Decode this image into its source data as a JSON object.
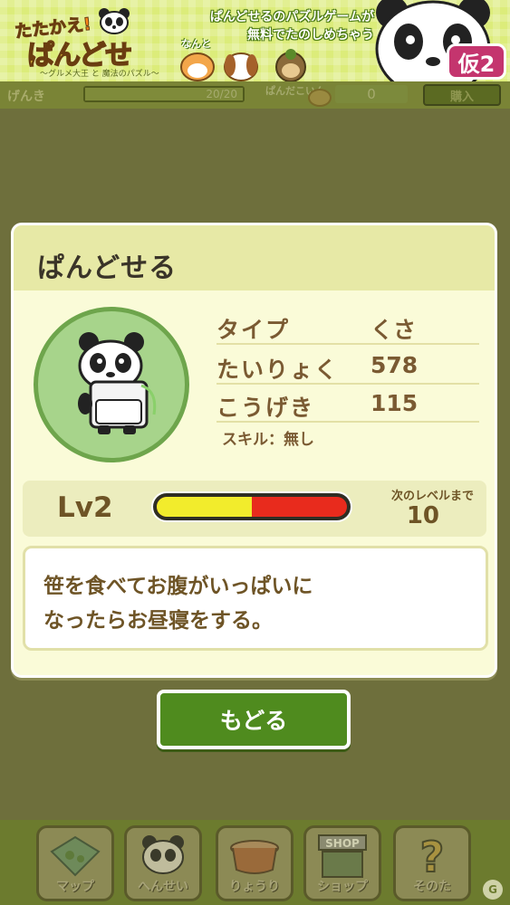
{
  "banner": {
    "logo_line1": "たたかえ!",
    "logo_line2": "ぱんどせる!!",
    "logo_subtitle": "〜グルメ大王 と 魔法のパズル〜",
    "promo_line1": "ぱんどせるのパズルゲームが",
    "promo_line2": "無料でたのしめちゃう",
    "nanto": "なんと",
    "version_badge": "仮2"
  },
  "status": {
    "genki_label": "げんき",
    "stamina_text": "20/20",
    "stamina_fraction": 1.0,
    "coin_label": "ぱんだこいん",
    "coin_value": "0",
    "buy_label": "購入"
  },
  "dialog": {
    "title": "ぱんどせる",
    "stats": [
      {
        "label": "タイプ",
        "value": "くさ"
      },
      {
        "label": "たいりょく",
        "value": "578"
      },
      {
        "label": "こうげき",
        "value": "115"
      }
    ],
    "skill": "スキル：無し",
    "level": "Lv2",
    "exp_fraction": 0.5,
    "next_level_label": "次のレベルまで",
    "next_level_value": "10",
    "description_line1": "笹を食べてお腹がいっぱいに",
    "description_line2": "なったらお昼寝をする。"
  },
  "back_button_label": "もどる",
  "nav": [
    {
      "label": "マップ",
      "icon": "map-icon"
    },
    {
      "label": "へんせい",
      "icon": "panda-icon"
    },
    {
      "label": "りょうり",
      "icon": "pot-icon"
    },
    {
      "label": "ショップ",
      "icon": "shop-icon",
      "sign": "SHOP"
    },
    {
      "label": "そのた",
      "icon": "question-icon",
      "glyph": "?"
    }
  ],
  "colors": {
    "accent_green": "#4f8b1e",
    "exp_yellow": "#f2ec2c",
    "exp_red": "#e82b1d"
  }
}
